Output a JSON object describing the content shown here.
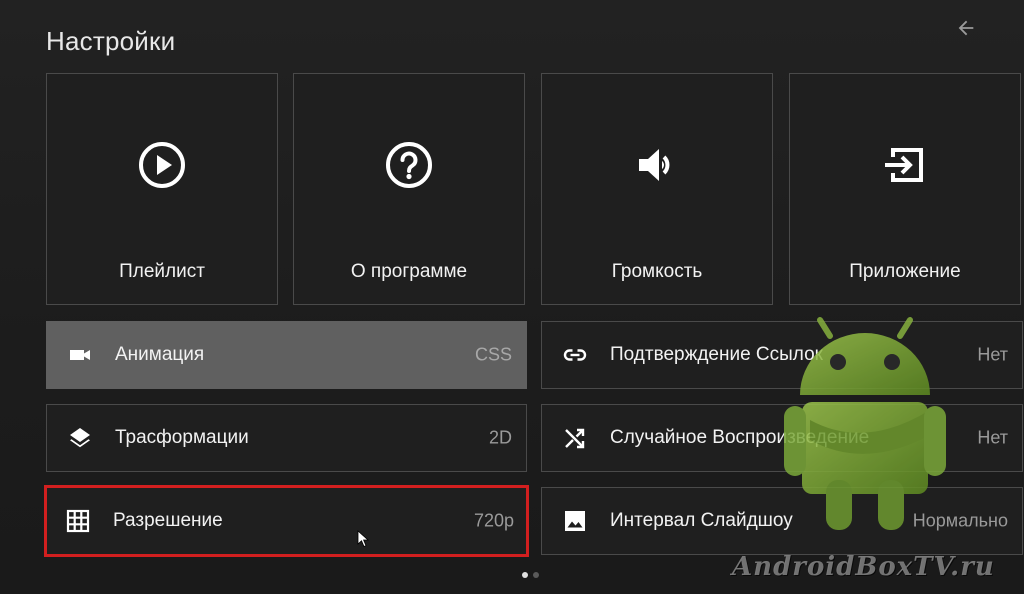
{
  "header": {
    "title": "Настройки"
  },
  "tiles": [
    {
      "label": "Плейлист",
      "icon": "play-circle-icon"
    },
    {
      "label": "О программе",
      "icon": "help-circle-icon"
    },
    {
      "label": "Громкость",
      "icon": "volume-icon"
    },
    {
      "label": "Приложение",
      "icon": "exit-to-app-icon"
    }
  ],
  "settings": {
    "left": [
      {
        "label": "Анимация",
        "value": "CSS",
        "icon": "videocam-icon",
        "state": "selected"
      },
      {
        "label": "Трасформации",
        "value": "2D",
        "icon": "layers-icon",
        "state": "normal"
      },
      {
        "label": "Разрешение",
        "value": "720p",
        "icon": "grid-icon",
        "state": "focused"
      }
    ],
    "right": [
      {
        "label": "Подтверждение Ссылок",
        "value": "Нет",
        "icon": "link-icon",
        "state": "normal"
      },
      {
        "label": "Случайное Воспроизведение",
        "value": "Нет",
        "icon": "shuffle-icon",
        "state": "normal"
      },
      {
        "label": "Интервал Слайдшоу",
        "value": "Нормально",
        "icon": "image-icon",
        "state": "normal"
      }
    ]
  },
  "pagination": {
    "current_page": 1,
    "total_pages": 2
  },
  "watermark": {
    "text": "AndroidBoxTV.ru"
  },
  "colors": {
    "background": "#1d1d1d",
    "tile_border": "#4a4a4a",
    "selected_row": "#606060",
    "focus_border": "#d21f1f",
    "value_text": "#9a9a9a",
    "android_green": "#7fae3a"
  }
}
